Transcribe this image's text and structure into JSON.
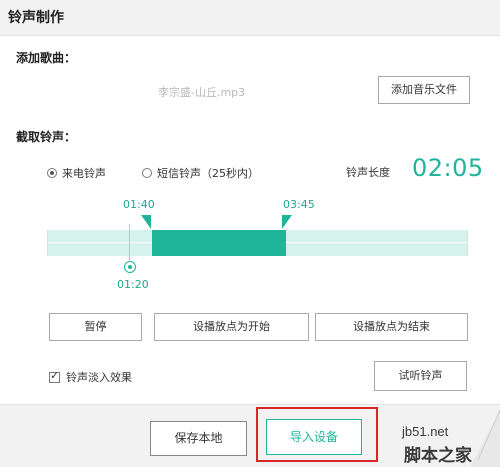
{
  "window": {
    "title": "铃声制作"
  },
  "add_song": {
    "label": "添加歌曲：",
    "filename": "李宗盛-山丘.mp3",
    "add_button": "添加音乐文件"
  },
  "ringtone": {
    "label": "截取铃声：",
    "options": [
      {
        "label": "来电铃声",
        "selected": true
      },
      {
        "label": "短信铃声（25秒内）",
        "selected": false
      }
    ],
    "length_label": "铃声长度",
    "length_value": "02:05",
    "start_time": "01:40",
    "end_time": "03:45",
    "playhead_time": "01:20",
    "accent_color": "#1fb59a"
  },
  "controls": {
    "pause": "暂停",
    "set_start": "设播放点为开始",
    "set_end": "设播放点为结束"
  },
  "fade": {
    "label": "铃声淡入效果",
    "checked": true,
    "check_mark": "✓"
  },
  "preview_button": "试听铃声",
  "footer": {
    "save_local": "保存本地",
    "import_device": "导入设备",
    "highlight_color": "#d9262c"
  },
  "watermark": {
    "line1": "jb51.net",
    "line2": "脚本之家"
  }
}
